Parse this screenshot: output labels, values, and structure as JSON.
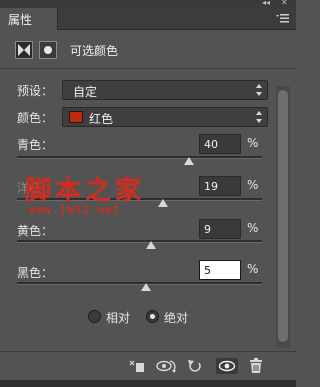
{
  "panel": {
    "tab_label": "属性",
    "adjustment_title": "可选颜色"
  },
  "preset": {
    "label": "预设：",
    "value": "自定"
  },
  "colors": {
    "label": "颜色：",
    "value": "红色",
    "swatch_color": "#c12a0a"
  },
  "sliders": [
    {
      "label": "青色：",
      "value": "40",
      "unit": "%",
      "level": 0.7
    },
    {
      "label": "洋红：",
      "value": "19",
      "unit": "%",
      "level": 0.595
    },
    {
      "label": "黄色：",
      "value": "9",
      "unit": "%",
      "level": 0.545
    },
    {
      "label": "黑色：",
      "value": "5",
      "unit": "%",
      "level": 0.525
    }
  ],
  "watermark": {
    "text": "脚本之家",
    "url": "www.jb51.net"
  },
  "method": {
    "options": [
      {
        "label": "相对",
        "selected": false
      },
      {
        "label": "绝对",
        "selected": true
      }
    ]
  },
  "footer_icons": [
    "clip-to-layer-icon",
    "view-previous-state-icon",
    "reset-icon",
    "visibility-icon",
    "delete-icon"
  ]
}
